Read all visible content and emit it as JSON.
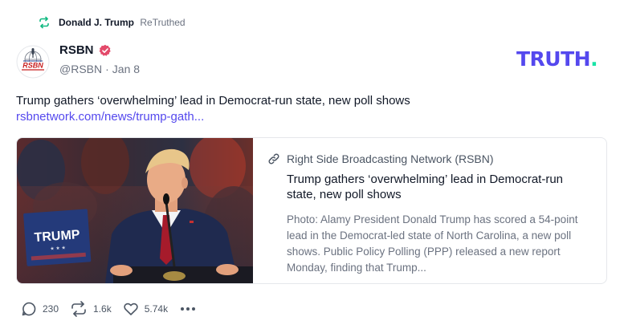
{
  "retruth": {
    "user": "Donald J. Trump",
    "label": "ReTruthed",
    "icon": "retruth-icon"
  },
  "author": {
    "name": "RSBN",
    "handle": "@RSBN",
    "separator": "·",
    "date": "Jan 8",
    "verified_icon": "verified-badge-icon",
    "avatar_text": "RSBN"
  },
  "logo": {
    "text": "TRUTH",
    "dot": "."
  },
  "post": {
    "text": "Trump gathers ‘overwhelming’ lead in Democrat-run state, new poll shows",
    "link": "rsbnetwork.com/news/trump-gath..."
  },
  "card": {
    "source": "Right Side Broadcasting Network (RSBN)",
    "title": "Trump gathers ‘overwhelming’ lead in Democrat-run state, new poll shows",
    "description": "Photo: Alamy President Donald Trump has scored a 54-point lead in the Democrat-led state of North Carolina, a new poll shows. Public Policy Polling (PPP) released a new report Monday, finding that Trump...",
    "sign_text": "TRUMP"
  },
  "actions": {
    "replies": "230",
    "retruths": "1.6k",
    "likes": "5.74k"
  },
  "colors": {
    "brand": "#5448ee",
    "brand_accent": "#17e4a6",
    "verified": "#e34a6a",
    "retruth_green": "#10b981"
  }
}
